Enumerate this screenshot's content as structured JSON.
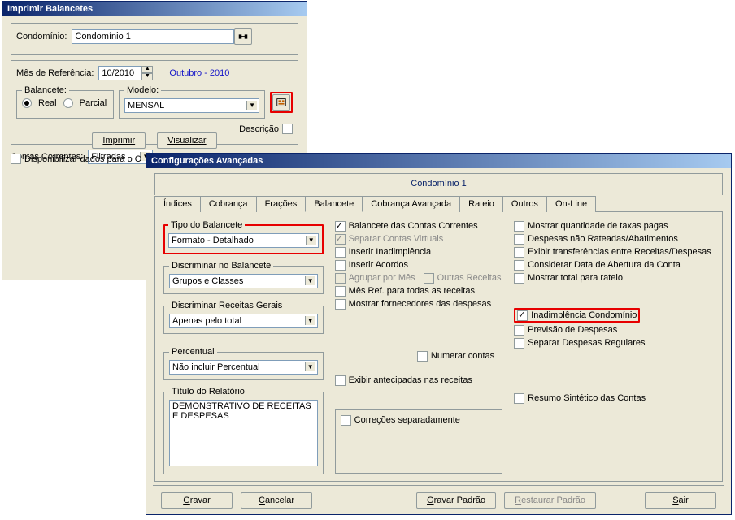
{
  "win1": {
    "title": "Imprimir Balancetes",
    "condo_label": "Condomínio:",
    "condo_value": "Condomínio 1",
    "mes_ref_label": "Mês de Referência:",
    "mes_ref_value": "10/2010",
    "mes_text": "Outubro - 2010",
    "balancete_legend": "Balancete:",
    "real_label": "Real",
    "parcial_label": "Parcial",
    "modelo_legend": "Modelo:",
    "modelo_value": "MENSAL",
    "descricao_label": "Descrição",
    "contas_label": "Contas Correntes:",
    "contas_value": "Filtradas",
    "btn_imprimir": "Imprimir",
    "btn_visualizar": "Visualizar",
    "disponibilizar": "Disponibilizar dados para o C"
  },
  "win2": {
    "title": "Configurações Avançadas",
    "condo_header": "Condomínio 1",
    "tabs": [
      "Índices",
      "Cobrança",
      "Frações",
      "Balancete",
      "Cobrança Avançada",
      "Rateio",
      "Outros",
      "On-Line"
    ],
    "active_tab": 3,
    "tipo_legend": "Tipo do Balancete",
    "tipo_value": "Formato - Detalhado",
    "discriminar_legend": "Discriminar no Balancete",
    "discriminar_value": "Grupos e Classes",
    "receitas_legend": "Discriminar Receitas Gerais",
    "receitas_value": "Apenas pelo total",
    "percentual_legend": "Percentual",
    "percentual_value": "Não incluir Percentual",
    "titulo_legend": "Título do Relatório",
    "titulo_value": "DEMONSTRATIVO DE RECEITAS E DESPESAS",
    "mid_checks": [
      {
        "label": "Balancete das Contas Correntes",
        "checked": true,
        "disabled": false
      },
      {
        "label": "Separar Contas Virtuais",
        "checked": true,
        "disabled": true
      },
      {
        "label": "Inserir Inadimplência",
        "checked": false,
        "disabled": false
      },
      {
        "label": "Inserir Acordos",
        "checked": false,
        "disabled": false
      },
      {
        "label": "Agrupar por Mês",
        "checked": false,
        "disabled": true,
        "extra": "Outras Receitas"
      },
      {
        "label": "Mês Ref. para todas as receitas",
        "checked": false,
        "disabled": false
      },
      {
        "label": "Mostrar fornecedores das despesas",
        "checked": false,
        "disabled": false
      }
    ],
    "numerar_label": "Numerar contas",
    "exibir_antecip_label": "Exibir antecipadas nas receitas",
    "correcoes_label": "Correções separadamente",
    "right_checks1": [
      {
        "label": "Mostrar quantidade de taxas pagas",
        "checked": false
      },
      {
        "label": "Despesas não Rateadas/Abatimentos",
        "checked": false
      },
      {
        "label": "Exibir transferências entre Receitas/Despesas",
        "checked": false
      },
      {
        "label": "Considerar Data de Abertura da Conta",
        "checked": false
      },
      {
        "label": "Mostrar total para rateio",
        "checked": false
      }
    ],
    "right_checks2": [
      {
        "label": "Inadimplência Condomínio",
        "checked": true,
        "highlight": true
      },
      {
        "label": "Previsão de Despesas",
        "checked": false
      },
      {
        "label": "Separar Despesas Regulares",
        "checked": false
      }
    ],
    "resumo_label": "Resumo Sintético das Contas",
    "btn_gravar": "Gravar",
    "btn_cancelar": "Cancelar",
    "btn_gravar_padrao": "Gravar Padrão",
    "btn_restaurar_padrao": "Restaurar Padrão",
    "btn_sair": "Sair"
  }
}
